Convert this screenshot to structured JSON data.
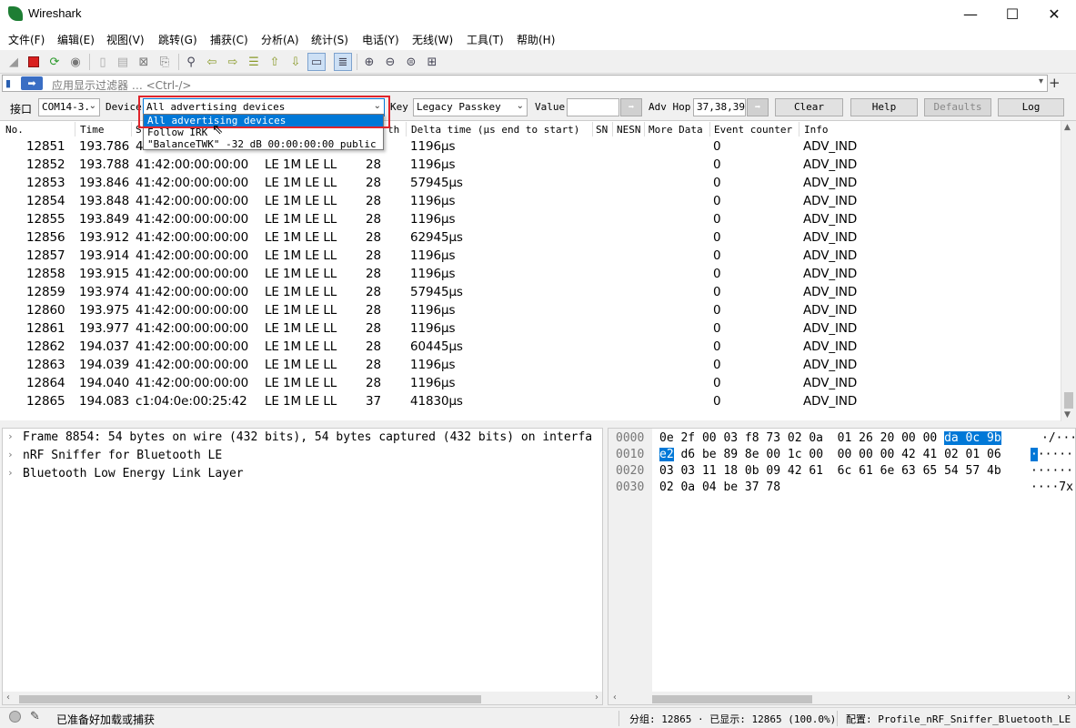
{
  "window": {
    "title": "Wireshark",
    "minimize": "—",
    "maximize": "☐",
    "close": "✕"
  },
  "menu": [
    "文件(F)",
    "编辑(E)",
    "视图(V)",
    "跳转(G)",
    "捕获(C)",
    "分析(A)",
    "统计(S)",
    "电话(Y)",
    "无线(W)",
    "工具(T)",
    "帮助(H)"
  ],
  "filter": {
    "placeholder": "应用显示过滤器 … <Ctrl-/>"
  },
  "interface_bar": {
    "interface_label": "接口",
    "interface_value": "COM14-3.",
    "device_label": "Device",
    "device_value": "All advertising devices",
    "key_label": "Key",
    "key_value": "Legacy Passkey",
    "value_label": "Value",
    "value_value": "",
    "adv_hop_label": "Adv Hop",
    "adv_hop_value": "37,38,39",
    "clear": "Clear",
    "help": "Help",
    "defaults": "Defaults",
    "log": "Log"
  },
  "dropdown": {
    "items": [
      "All advertising devices",
      "Follow IRK",
      "\"BalanceTWK\"  -32 dB  00:00:00:00  public"
    ]
  },
  "columns": [
    "No.",
    "Time",
    "S",
    "th",
    "Delta time (µs end to start)",
    "SN",
    "NESN",
    "More Data",
    "Event counter",
    "Info"
  ],
  "packets": [
    {
      "no": "12851",
      "time": "193.786",
      "src": "41",
      "proto": "",
      "len": "",
      "delta": "1196µs",
      "ec": "0",
      "info": "ADV_IND"
    },
    {
      "no": "12852",
      "time": "193.788",
      "src": "41:42:00:00:00:00",
      "proto": "LE 1M LE LL",
      "len": "28",
      "delta": "1196µs",
      "ec": "0",
      "info": "ADV_IND"
    },
    {
      "no": "12853",
      "time": "193.846",
      "src": "41:42:00:00:00:00",
      "proto": "LE 1M LE LL",
      "len": "28",
      "delta": "57945µs",
      "ec": "0",
      "info": "ADV_IND"
    },
    {
      "no": "12854",
      "time": "193.848",
      "src": "41:42:00:00:00:00",
      "proto": "LE 1M LE LL",
      "len": "28",
      "delta": "1196µs",
      "ec": "0",
      "info": "ADV_IND"
    },
    {
      "no": "12855",
      "time": "193.849",
      "src": "41:42:00:00:00:00",
      "proto": "LE 1M LE LL",
      "len": "28",
      "delta": "1196µs",
      "ec": "0",
      "info": "ADV_IND"
    },
    {
      "no": "12856",
      "time": "193.912",
      "src": "41:42:00:00:00:00",
      "proto": "LE 1M LE LL",
      "len": "28",
      "delta": "62945µs",
      "ec": "0",
      "info": "ADV_IND"
    },
    {
      "no": "12857",
      "time": "193.914",
      "src": "41:42:00:00:00:00",
      "proto": "LE 1M LE LL",
      "len": "28",
      "delta": "1196µs",
      "ec": "0",
      "info": "ADV_IND"
    },
    {
      "no": "12858",
      "time": "193.915",
      "src": "41:42:00:00:00:00",
      "proto": "LE 1M LE LL",
      "len": "28",
      "delta": "1196µs",
      "ec": "0",
      "info": "ADV_IND"
    },
    {
      "no": "12859",
      "time": "193.974",
      "src": "41:42:00:00:00:00",
      "proto": "LE 1M LE LL",
      "len": "28",
      "delta": "57945µs",
      "ec": "0",
      "info": "ADV_IND"
    },
    {
      "no": "12860",
      "time": "193.975",
      "src": "41:42:00:00:00:00",
      "proto": "LE 1M LE LL",
      "len": "28",
      "delta": "1196µs",
      "ec": "0",
      "info": "ADV_IND"
    },
    {
      "no": "12861",
      "time": "193.977",
      "src": "41:42:00:00:00:00",
      "proto": "LE 1M LE LL",
      "len": "28",
      "delta": "1196µs",
      "ec": "0",
      "info": "ADV_IND"
    },
    {
      "no": "12862",
      "time": "194.037",
      "src": "41:42:00:00:00:00",
      "proto": "LE 1M LE LL",
      "len": "28",
      "delta": "60445µs",
      "ec": "0",
      "info": "ADV_IND"
    },
    {
      "no": "12863",
      "time": "194.039",
      "src": "41:42:00:00:00:00",
      "proto": "LE 1M LE LL",
      "len": "28",
      "delta": "1196µs",
      "ec": "0",
      "info": "ADV_IND"
    },
    {
      "no": "12864",
      "time": "194.040",
      "src": "41:42:00:00:00:00",
      "proto": "LE 1M LE LL",
      "len": "28",
      "delta": "1196µs",
      "ec": "0",
      "info": "ADV_IND"
    },
    {
      "no": "12865",
      "time": "194.083",
      "src": "c1:04:0e:00:25:42",
      "proto": "LE 1M LE LL",
      "len": "37",
      "delta": "41830µs",
      "ec": "0",
      "info": "ADV_IND"
    }
  ],
  "details": [
    "Frame 8854: 54 bytes on wire (432 bits), 54 bytes captured (432 bits) on interfa",
    "nRF Sniffer for Bluetooth LE",
    "Bluetooth Low Energy Link Layer"
  ],
  "hex": [
    {
      "off": "0000",
      "pre": "0e 2f 00 03 f8 73 02 0a  01 26 20 00 00 ",
      "hl": "da 0c 9b",
      "post": "",
      "ascii": "·/···s"
    },
    {
      "off": "0010",
      "pre": "",
      "hl": "e2",
      "post": " d6 be 89 8e 00 1c 00  00 00 00 42 41 02 01 06",
      "ascii": "······"
    },
    {
      "off": "0020",
      "pre": "03 03 11 18 0b 09 42 61  6c 61 6e 63 65 54 57 4b",
      "hl": "",
      "post": "",
      "ascii": "······"
    },
    {
      "off": "0030",
      "pre": "02 0a 04 be 37 78",
      "hl": "",
      "post": "",
      "ascii": "····7x"
    }
  ],
  "status": {
    "ready": "已准备好加载或捕获",
    "packets": "分组: 12865 · 已显示: 12865 (100.0%)",
    "profile": "配置: Profile_nRF_Sniffer_Bluetooth_LE"
  },
  "colors": {
    "accent": "#0078d7",
    "highlight_box": "#e0242b"
  }
}
